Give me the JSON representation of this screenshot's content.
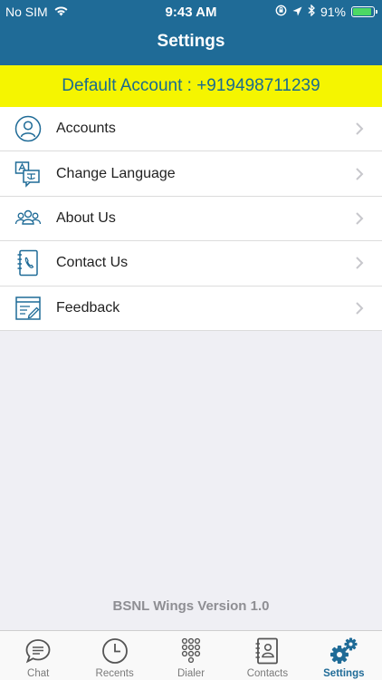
{
  "status_bar": {
    "carrier": "No SIM",
    "time": "9:43 AM",
    "battery_percent": "91%",
    "battery_level": 0.91
  },
  "header": {
    "title": "Settings",
    "color": "#1f6b97"
  },
  "default_account": "Default Account : +919498711239",
  "menu": {
    "items": [
      {
        "label": "Accounts",
        "icon": "user-circle-icon"
      },
      {
        "label": "Change Language",
        "icon": "language-icon"
      },
      {
        "label": "About Us",
        "icon": "group-icon"
      },
      {
        "label": "Contact Us",
        "icon": "phone-book-icon"
      },
      {
        "label": "Feedback",
        "icon": "feedback-form-icon"
      }
    ]
  },
  "footer": {
    "version": "BSNL Wings Version 1.0"
  },
  "tabbar": {
    "tabs": [
      {
        "label": "Chat",
        "icon": "chat-bubble-icon"
      },
      {
        "label": "Recents",
        "icon": "clock-icon"
      },
      {
        "label": "Dialer",
        "icon": "keypad-icon"
      },
      {
        "label": "Contacts",
        "icon": "contacts-icon"
      },
      {
        "label": "Settings",
        "icon": "gears-icon",
        "active": true
      }
    ]
  }
}
